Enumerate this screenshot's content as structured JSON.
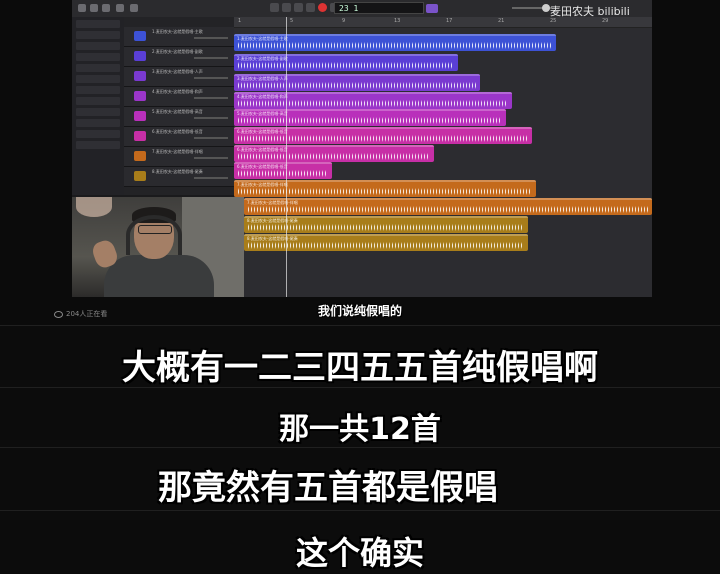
{
  "daw": {
    "lcd_text": "23 1",
    "watermark": "麦田农夫 bilibili",
    "ruler_numbers": [
      "1",
      "5",
      "9",
      "13",
      "17",
      "21",
      "25",
      "29"
    ],
    "track_names": [
      "1.麦田农夫-这就是假唱-主歌",
      "2.麦田农夫-这就是假唱-副歌",
      "3.麦田农夫-这就是假唱-人声",
      "4.麦田农夫-这就是假唱-和声",
      "5.麦田农夫-这就是假唱-高音",
      "6.麦田农夫-这就是假唱-低音",
      "7.麦田农夫-这就是假唱-伴唱",
      "8.麦田农夫-这就是假唱-尾奏"
    ],
    "region_colors": {
      "blue": "#3d52d6",
      "indigo": "#5a3fd6",
      "violet": "#7a3ad0",
      "purple": "#9b36c9",
      "magenta": "#b930bb",
      "pink": "#c72fa6",
      "orange": "#c46a1c",
      "gold": "#a87d1a"
    }
  },
  "stream": {
    "viewers": "204人正在看",
    "subtitle_small": "我们说纯假唱的"
  },
  "subtitles": [
    "大概有一二三四五五首纯假唱啊",
    "那一共12首",
    "那竟然有五首都是假唱",
    "这个确实"
  ]
}
